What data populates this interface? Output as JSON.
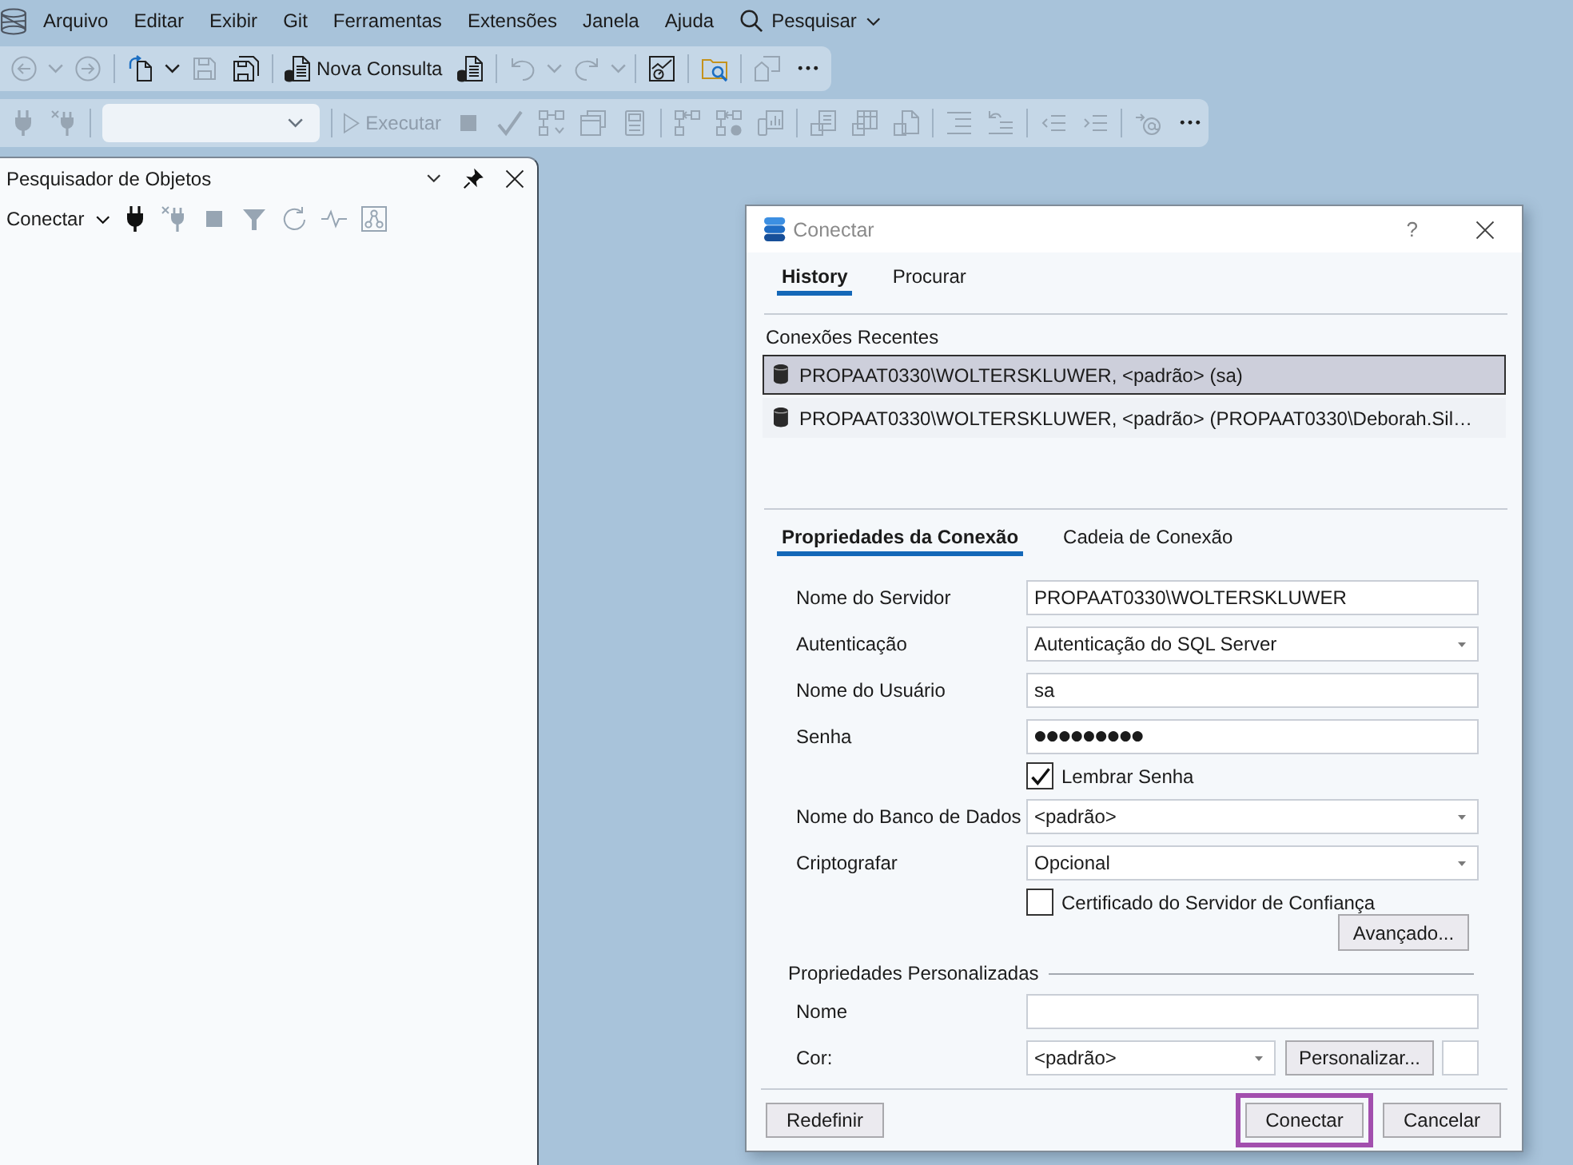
{
  "menu_bar": {
    "items": [
      "Arquivo",
      "Editar",
      "Exibir",
      "Git",
      "Ferramentas",
      "Extensões",
      "Janela",
      "Ajuda"
    ],
    "search_label": "Pesquisar"
  },
  "toolbar_standard": [
    {
      "kind": "back-arrow",
      "disabled": true
    },
    {
      "kind": "chevron-down",
      "disabled": true
    },
    {
      "kind": "forward-arrow",
      "disabled": true
    },
    {
      "kind": "separator"
    },
    {
      "kind": "new-file",
      "disabled": false
    },
    {
      "kind": "chevron-down",
      "disabled": false
    },
    {
      "kind": "floppy-disk",
      "disabled": true
    },
    {
      "kind": "floppy-disks",
      "disabled": false
    },
    {
      "kind": "separator"
    },
    {
      "kind": "query-document",
      "label": "Nova Consulta",
      "disabled": false
    },
    {
      "kind": "query-document",
      "disabled": false
    },
    {
      "kind": "separator"
    },
    {
      "kind": "undo",
      "disabled": true
    },
    {
      "kind": "chevron-down",
      "disabled": true
    },
    {
      "kind": "redo",
      "disabled": true
    },
    {
      "kind": "chevron-down",
      "disabled": true
    },
    {
      "kind": "separator"
    },
    {
      "kind": "chart-window",
      "disabled": false
    },
    {
      "kind": "separator"
    },
    {
      "kind": "folder-search",
      "disabled": false
    },
    {
      "kind": "separator"
    },
    {
      "kind": "window-stack",
      "disabled": true
    },
    {
      "kind": "more",
      "disabled": false
    }
  ],
  "toolbar_query": [
    {
      "kind": "plug",
      "disabled": true
    },
    {
      "kind": "unplug",
      "disabled": true
    },
    {
      "kind": "separator"
    },
    {
      "kind": "combo"
    },
    {
      "kind": "separator"
    },
    {
      "kind": "play",
      "label": "Executar",
      "disabled": true
    },
    {
      "kind": "stop-square",
      "disabled": true
    },
    {
      "kind": "check",
      "disabled": true
    },
    {
      "kind": "diagram",
      "disabled": true
    },
    {
      "kind": "stacked-windows",
      "disabled": true
    },
    {
      "kind": "form-panel",
      "disabled": true
    },
    {
      "kind": "separator"
    },
    {
      "kind": "boxes-arrow",
      "disabled": true
    },
    {
      "kind": "boxes-check",
      "disabled": true
    },
    {
      "kind": "bar-chart",
      "disabled": true
    },
    {
      "kind": "separator"
    },
    {
      "kind": "document-lines",
      "disabled": true
    },
    {
      "kind": "table-grid",
      "disabled": true
    },
    {
      "kind": "file-corner",
      "disabled": true
    },
    {
      "kind": "separator"
    },
    {
      "kind": "indent-lines",
      "disabled": true
    },
    {
      "kind": "undo-lines",
      "disabled": true
    },
    {
      "kind": "separator"
    },
    {
      "kind": "outdent",
      "disabled": true
    },
    {
      "kind": "indent",
      "disabled": true
    },
    {
      "kind": "separator"
    },
    {
      "kind": "arrow-at",
      "disabled": true
    },
    {
      "kind": "more",
      "disabled": false
    }
  ],
  "object_explorer": {
    "title": "Pesquisador de Objetos",
    "toolbar": [
      {
        "kind": "text-menu",
        "label": "Conectar",
        "disabled": false
      },
      {
        "kind": "plug",
        "disabled": false
      },
      {
        "kind": "unplug",
        "disabled": true
      },
      {
        "kind": "stop-square",
        "disabled": true
      },
      {
        "kind": "filter",
        "disabled": true
      },
      {
        "kind": "refresh",
        "disabled": true
      },
      {
        "kind": "pulse",
        "disabled": true
      },
      {
        "kind": "network-box",
        "disabled": true
      }
    ]
  },
  "dialog": {
    "title": "Conectar",
    "help_label": "?",
    "tabs": [
      {
        "label": "History",
        "selected": true
      },
      {
        "label": "Procurar",
        "selected": false
      }
    ],
    "recent": {
      "heading": "Conexões Recentes",
      "items": [
        {
          "text": "PROPAAT0330\\WOLTERSKLUWER, <padrão> (sa)",
          "selected": true
        },
        {
          "text": "PROPAAT0330\\WOLTERSKLUWER, <padrão> (PROPAAT0330\\Deborah.Sil…",
          "selected": false
        }
      ]
    },
    "property_tabs": [
      {
        "label": "Propriedades da Conexão",
        "selected": true
      },
      {
        "label": "Cadeia de Conexão",
        "selected": false
      }
    ],
    "fields": [
      {
        "kind": "text",
        "label": "Nome do Servidor",
        "value": "PROPAAT0330\\WOLTERSKLUWER"
      },
      {
        "kind": "select",
        "label": "Autenticação",
        "value": "Autenticação do SQL Server"
      },
      {
        "kind": "text",
        "label": "Nome do Usuário",
        "value": "sa"
      },
      {
        "kind": "password",
        "label": "Senha",
        "value": "●●●●●●●●●"
      },
      {
        "kind": "checkbox",
        "label": "Lembrar Senha",
        "checked": true
      },
      {
        "kind": "select",
        "label": "Nome do Banco de Dados",
        "value": "<padrão>"
      },
      {
        "kind": "select",
        "label": "Criptografar",
        "value": "Opcional"
      },
      {
        "kind": "checkbox",
        "label": "Certificado do Servidor de Confiança",
        "checked": false
      },
      {
        "kind": "button",
        "label": "Avançado..."
      }
    ],
    "custom_properties": {
      "heading": "Propriedades Personalizadas",
      "fields": [
        {
          "kind": "text",
          "label": "Nome"
        },
        {
          "kind": "color-select",
          "label": "Cor:",
          "value": "<padrão>",
          "button": "Personalizar..."
        }
      ]
    },
    "buttons": [
      {
        "label": "Redefinir",
        "highlighted": false
      },
      {
        "label": "Conectar",
        "highlighted": true
      },
      {
        "label": "Cancelar",
        "highlighted": false
      }
    ]
  }
}
